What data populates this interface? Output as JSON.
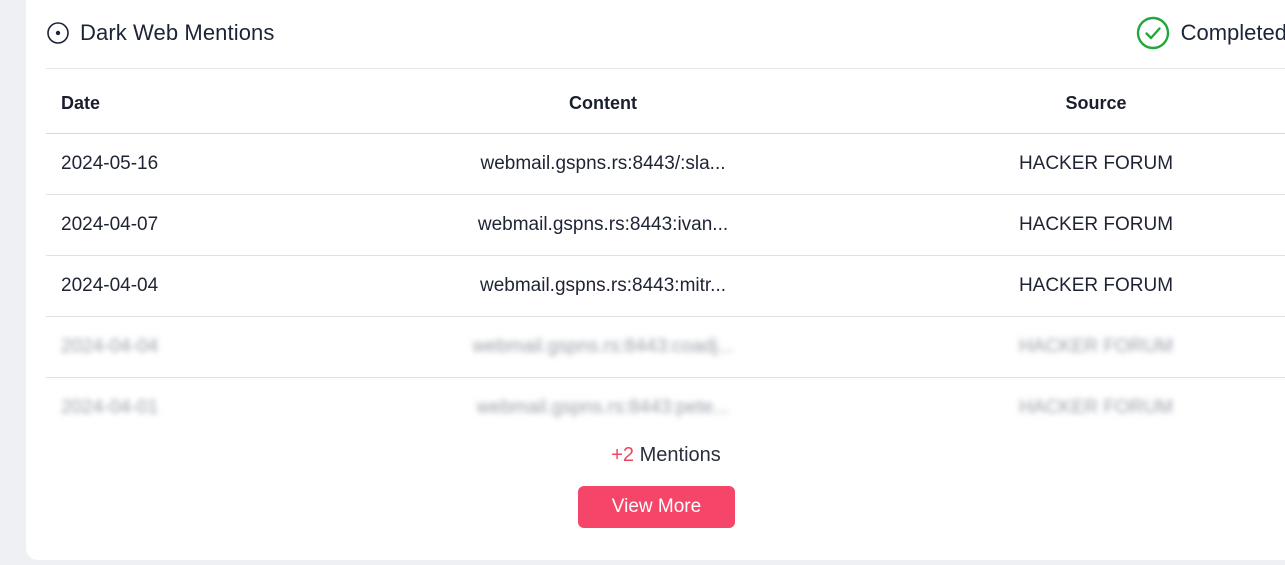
{
  "panel": {
    "title": "Dark Web Mentions",
    "title_icon": "target-circle-icon",
    "status": "Completed",
    "status_icon": "check-circle-icon",
    "status_color": "#22a83a"
  },
  "table": {
    "columns": [
      "Date",
      "Content",
      "Source"
    ],
    "rows": [
      {
        "date": "2024-05-16",
        "content": "webmail.gspns.rs:8443/:sla...",
        "source": "HACKER FORUM"
      },
      {
        "date": "2024-04-07",
        "content": "webmail.gspns.rs:8443:ivan...",
        "source": "HACKER FORUM"
      },
      {
        "date": "2024-04-04",
        "content": "webmail.gspns.rs:8443:mitr...",
        "source": "HACKER FORUM"
      },
      {
        "date": "2024-04-04",
        "content": "webmail.gspns.rs:8443:coadj...",
        "source": "HACKER FORUM"
      },
      {
        "date": "2024-04-01",
        "content": "webmail.gspns.rs:8443:pete...",
        "source": "HACKER FORUM"
      }
    ]
  },
  "footer": {
    "more_count": "+2",
    "more_label": " Mentions",
    "button_label": "View More"
  },
  "colors": {
    "accent": "#f5466a",
    "count": "#f0455d"
  }
}
